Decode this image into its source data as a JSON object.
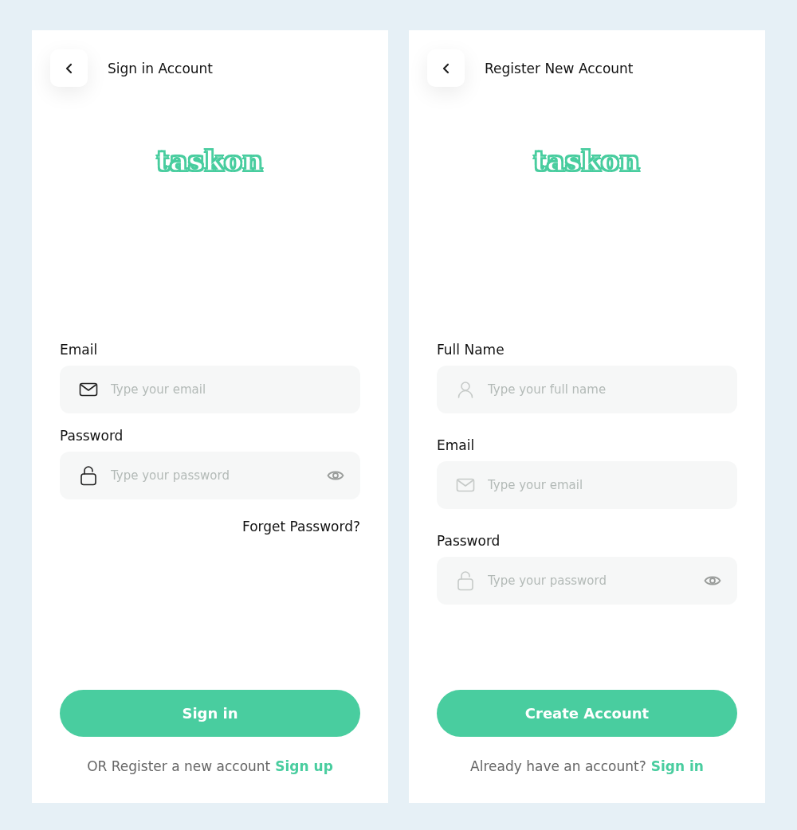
{
  "panels": [
    {
      "header": {
        "title": "Sign in Account"
      },
      "logo": "taskon",
      "fields": [
        {
          "kind": "email",
          "label": "Email",
          "placeholder": "Type your email",
          "highlighted": true
        },
        {
          "kind": "password",
          "label": "Password",
          "placeholder": "Type your password",
          "highlighted": true
        }
      ],
      "forgot_link": "Forget Password?",
      "primary_button": "Sign in",
      "footer": {
        "text": "OR Register a new account",
        "link": "Sign up"
      }
    },
    {
      "header": {
        "title": "Register New Account"
      },
      "logo": "taskon",
      "fields": [
        {
          "kind": "name",
          "label": "Full Name",
          "placeholder": "Type your full name",
          "highlighted": false
        },
        {
          "kind": "email",
          "label": "Email",
          "placeholder": "Type your email",
          "highlighted": false
        },
        {
          "kind": "password",
          "label": "Password",
          "placeholder": "Type your password",
          "highlighted": false
        }
      ],
      "primary_button": "Create Account",
      "footer": {
        "text": "Already have an account?",
        "link": "Sign in"
      }
    }
  ]
}
